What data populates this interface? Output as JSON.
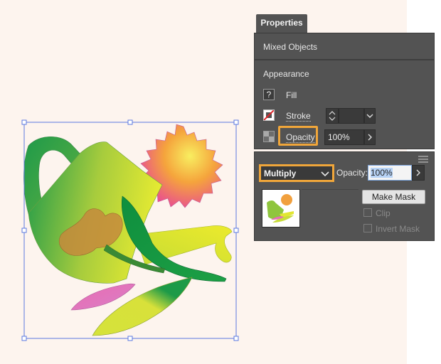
{
  "properties_panel": {
    "tab_label": "Properties",
    "selection_type": "Mixed Objects",
    "appearance": {
      "title": "Appearance",
      "fill_label": "Fill",
      "fill_icon_glyph": "?",
      "stroke_label": "Stroke",
      "opacity_label": "Opacity",
      "opacity_value": "100%"
    }
  },
  "transparency_panel": {
    "blend_mode": "Multiply",
    "opacity_label": "Opacity:",
    "opacity_value": "100%",
    "make_mask_label": "Make Mask",
    "clip_label": "Clip",
    "invert_mask_label": "Invert Mask"
  },
  "colors": {
    "highlight": "#f0a63a",
    "panel_bg": "#535353",
    "canvas_bg": "#fdf4ee",
    "selection": "#5a78e0"
  }
}
